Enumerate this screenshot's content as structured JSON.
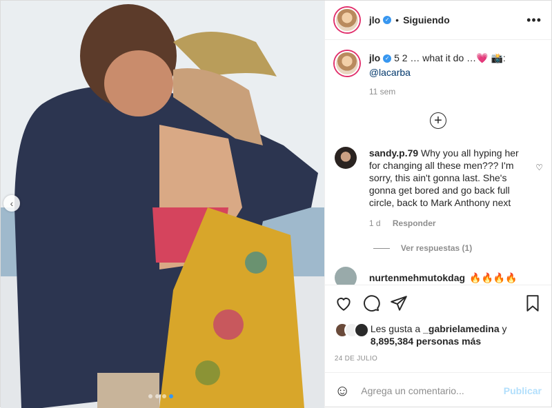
{
  "header": {
    "username": "jlo",
    "separator": "•",
    "follow_status": "Siguiendo",
    "more_label": "•••"
  },
  "caption": {
    "username": "jlo",
    "text": "5 2 … what it do …💗 📸:",
    "mention": "@lacarba",
    "time": "11 sem"
  },
  "comments": [
    {
      "username": "sandy.p.79",
      "text": "Why you all hyping her for changing all these men??? I'm sorry, this ain't gonna last. She's gonna get bored and go back full circle, back to Mark Anthony next",
      "age": "1 d",
      "reply_label": "Responder",
      "view_replies": "Ver respuestas (1)"
    },
    {
      "username": "nurtenmehmutokdag",
      "text": "🔥🔥🔥🔥"
    }
  ],
  "actions": {
    "likes_prefix": "Les gusta a",
    "likes_user": "_gabrielamedina",
    "likes_conj": "y",
    "likes_others": "8,895,384 personas más",
    "date": "24 DE JULIO"
  },
  "add_comment": {
    "placeholder": "Agrega un comentario...",
    "publish_label": "Publicar"
  },
  "carousel": {
    "prev_glyph": "‹"
  },
  "colors": {
    "accent": "#3897f0",
    "publish_disabled": "#b2dffc",
    "story_ring": "#e1306c"
  }
}
